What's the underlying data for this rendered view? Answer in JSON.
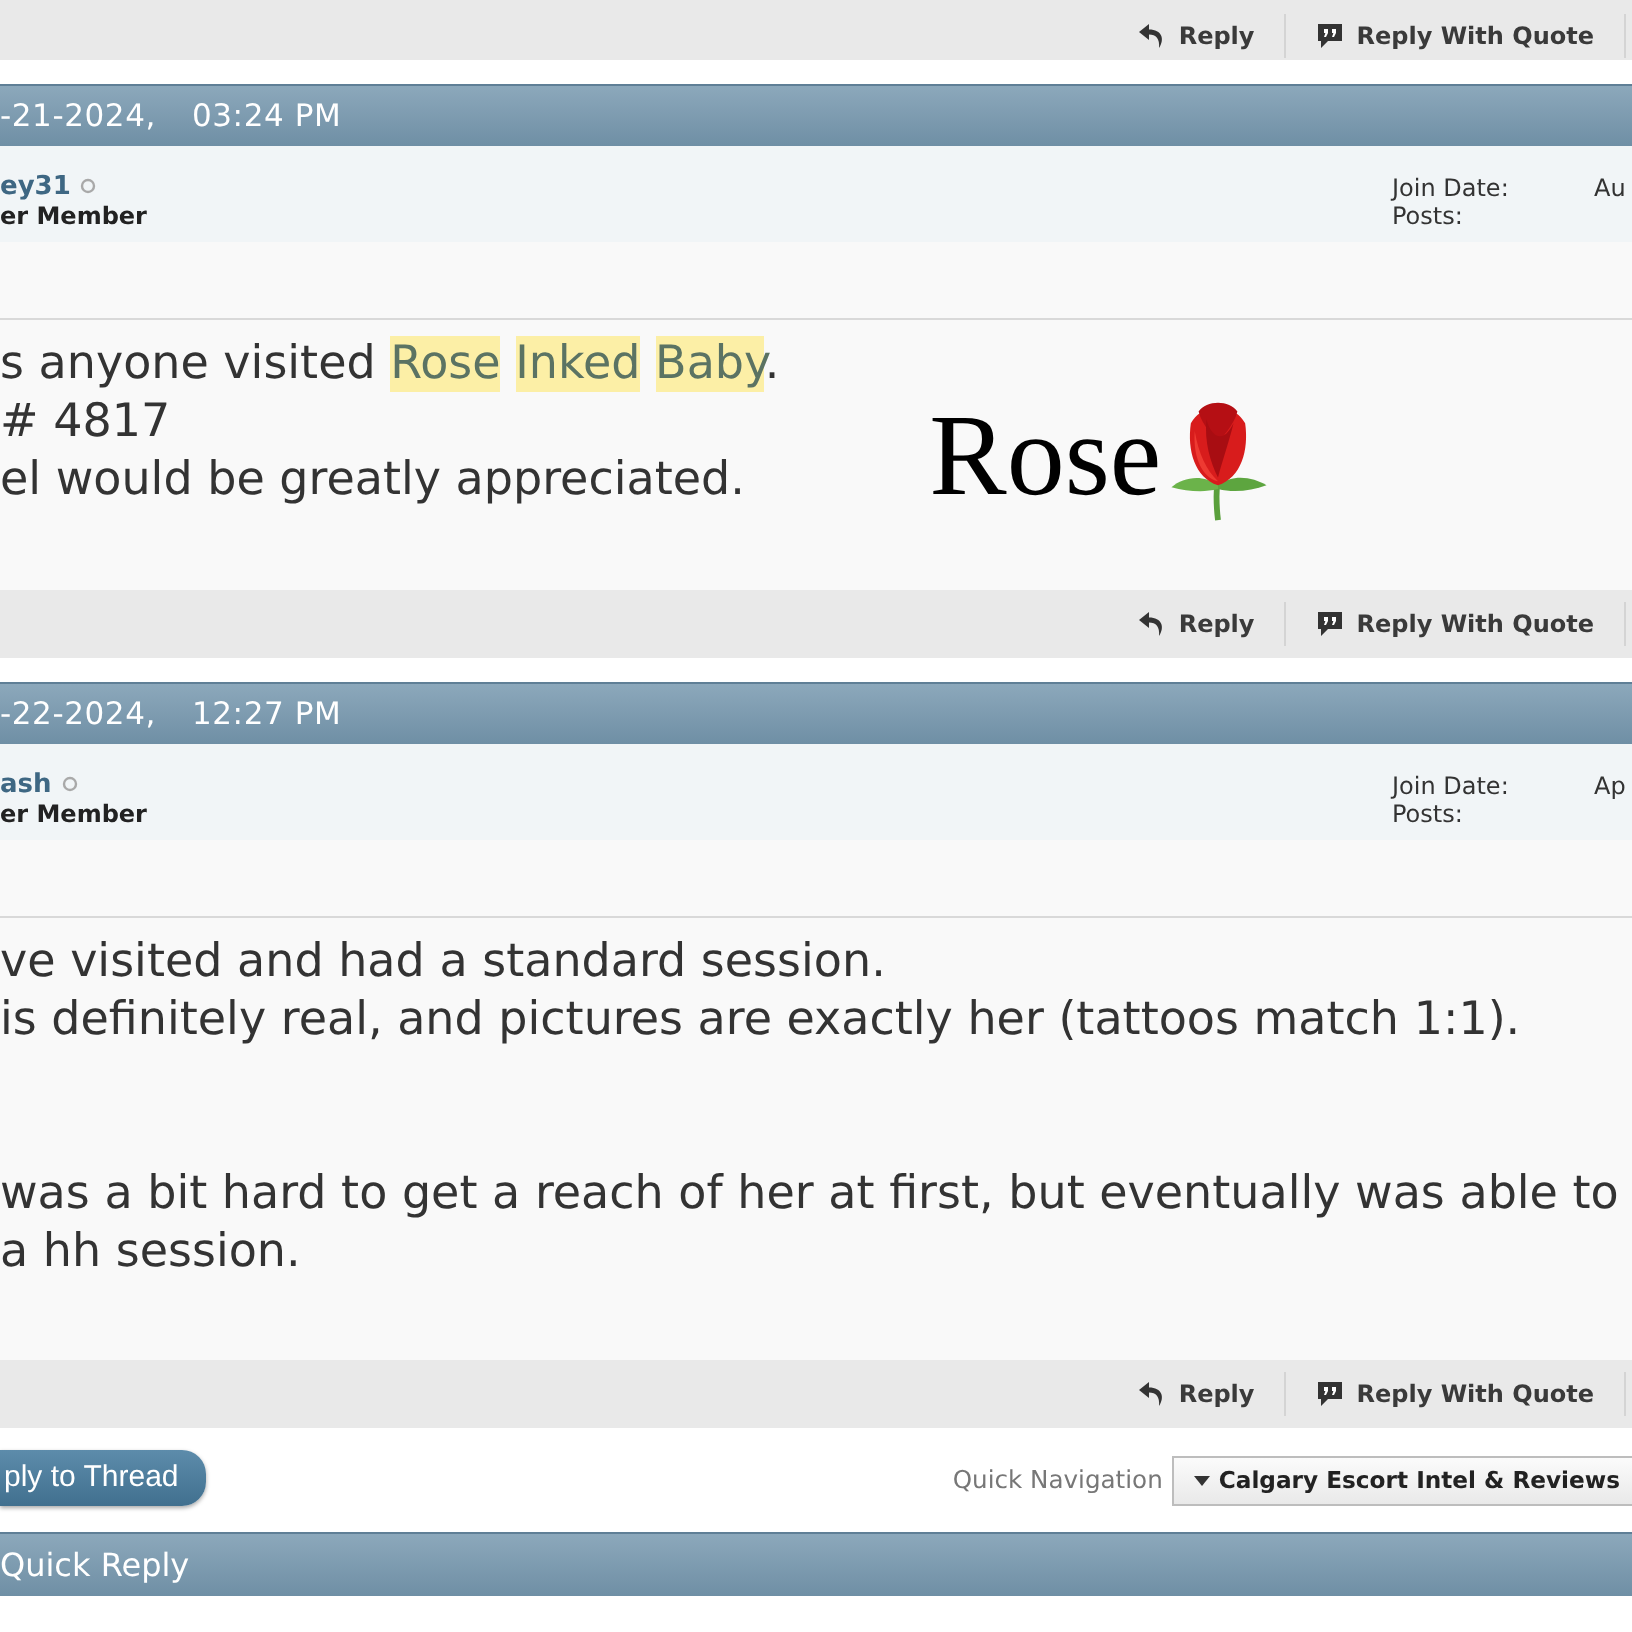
{
  "top_action_bar": {
    "buttons": [
      {
        "kind": "reply",
        "label": "Reply"
      },
      {
        "kind": "quote",
        "label": "Reply With Quote"
      }
    ]
  },
  "posts": [
    {
      "date": "-21-2024,",
      "time": "03:24 PM",
      "username": "ey31",
      "online": false,
      "user_title": "er Member",
      "join_date_label": "Join Date:",
      "join_date_value": "Au",
      "posts_label": "Posts:",
      "paragraphs": [
        {
          "lines": [
            {
              "segments": [
                {
                  "text": "s anyone visited ",
                  "highlighted": false
                },
                {
                  "text": "Rose ",
                  "highlighted": true
                },
                {
                  "text": "Inked ",
                  "highlighted": true
                },
                {
                  "text": "Baby",
                  "highlighted": true
                },
                {
                  "text": ".",
                  "highlighted": false
                }
              ]
            },
            {
              "segments": [
                {
                  "text": "# 4817",
                  "highlighted": false
                }
              ]
            },
            {
              "segments": [
                {
                  "text": "el would be greatly appreciated.",
                  "highlighted": false
                }
              ]
            }
          ]
        }
      ],
      "image": {
        "text": "Rose"
      },
      "actions": [
        {
          "kind": "reply",
          "label": "Reply"
        },
        {
          "kind": "quote",
          "label": "Reply With Quote"
        }
      ]
    },
    {
      "date": "-22-2024,",
      "time": "12:27 PM",
      "username": "ash",
      "online": false,
      "user_title": "er Member",
      "join_date_label": "Join Date:",
      "join_date_value": "Ap",
      "posts_label": "Posts:",
      "paragraphs": [
        {
          "lines": [
            {
              "segments": [
                {
                  "text": "ve visited and had a standard session.",
                  "highlighted": false
                }
              ]
            },
            {
              "segments": [
                {
                  "text": "is definitely real, and pictures are exactly her (tattoos match 1:1).",
                  "highlighted": false
                }
              ]
            }
          ]
        },
        {
          "lines": [
            {
              "segments": [
                {
                  "text": "was a bit hard to get a reach of her at first, but eventually was able to",
                  "highlighted": false
                }
              ]
            },
            {
              "segments": [
                {
                  "text": "a hh session.",
                  "highlighted": false
                }
              ]
            }
          ]
        }
      ],
      "actions": [
        {
          "kind": "reply",
          "label": "Reply"
        },
        {
          "kind": "quote",
          "label": "Reply With Quote"
        }
      ]
    }
  ],
  "thread_actions": {
    "reply_button": "ply to Thread",
    "quick_navigation_label": "Quick Navigation",
    "quick_navigation_value": "Calgary Escort Intel & Reviews"
  },
  "quick_reply": {
    "title": "Quick Reply"
  }
}
